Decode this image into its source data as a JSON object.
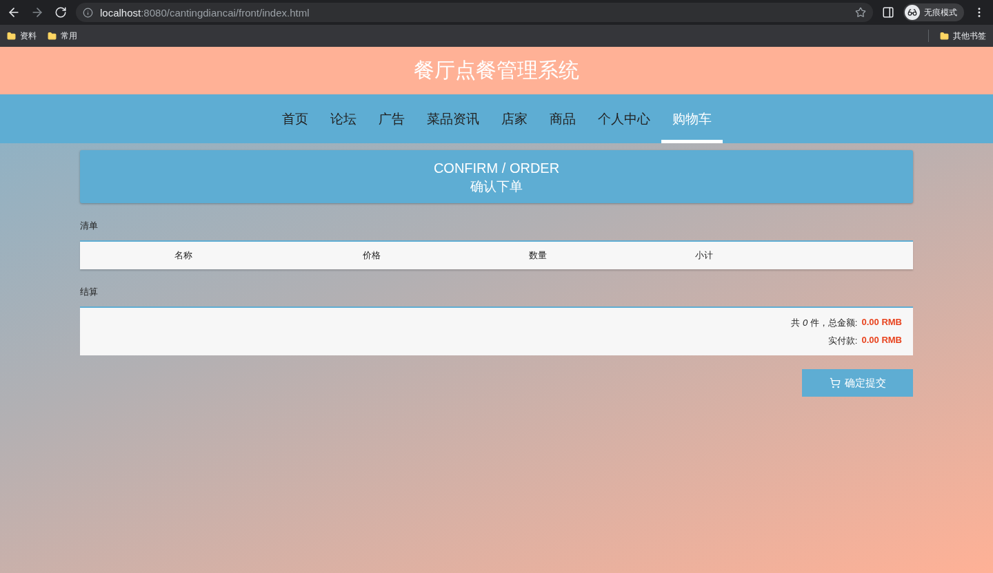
{
  "browser": {
    "url": "**localhost**:8080/cantingdiancai/front/index.html",
    "profile": "无痕模式",
    "bookmarks": [
      "资料",
      "常用"
    ],
    "other_bookmarks": "其他书签"
  },
  "site_title": "餐厅点餐管理系统",
  "nav": [
    {
      "label": "首页",
      "selected": false
    },
    {
      "label": "论坛",
      "selected": false
    },
    {
      "label": "广告",
      "selected": false
    },
    {
      "label": "菜品资讯",
      "selected": false
    },
    {
      "label": "店家",
      "selected": false
    },
    {
      "label": "商品",
      "selected": false
    },
    {
      "label": "个人中心",
      "selected": false
    },
    {
      "label": "购物车",
      "selected": true
    }
  ],
  "banner": {
    "title": "CONFIRM / ORDER",
    "subtitle": "确认下单"
  },
  "list_section": {
    "label": "清单",
    "columns": [
      "名称",
      "价格",
      "数量",
      "小计"
    ]
  },
  "checkout_section": {
    "label": "结算",
    "summary": "共 *0* 件，总金额:",
    "total": "0.00 RMB",
    "paid_label": "实付款:",
    "paid": "0.00 RMB"
  },
  "submit_button": "确定提交"
}
